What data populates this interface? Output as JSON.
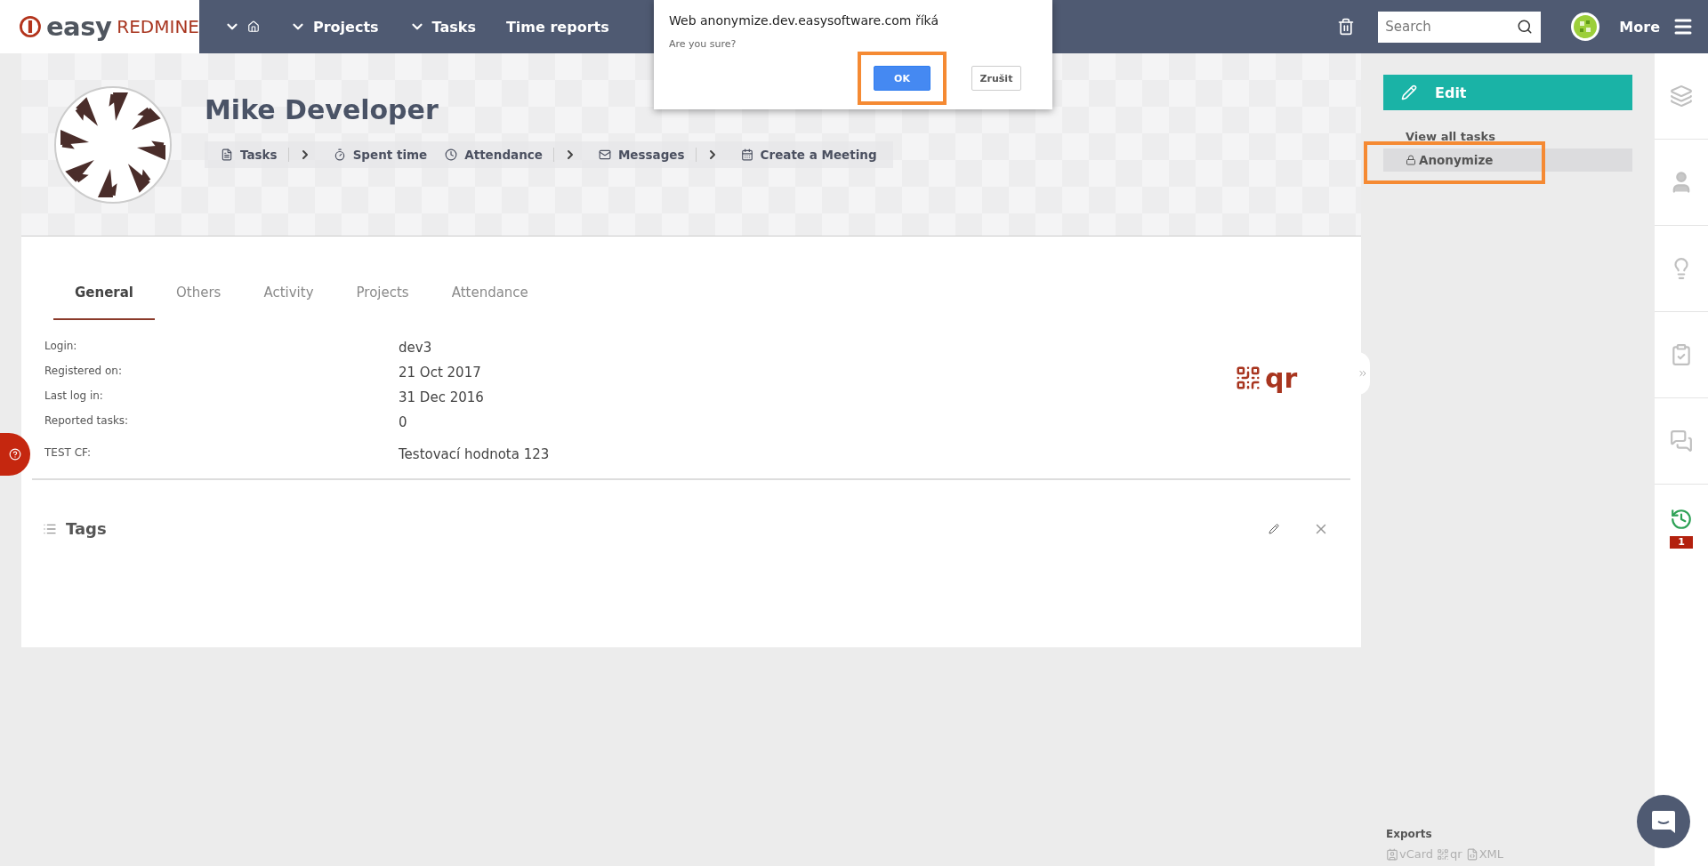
{
  "logo": {
    "brand": "easy",
    "product": "REDMINE"
  },
  "top_nav": {
    "items": [
      {
        "kind": "home",
        "has_menu": true
      },
      {
        "kind": "link",
        "label": "Projects",
        "has_menu": true
      },
      {
        "kind": "link",
        "label": "Tasks",
        "has_menu": true
      },
      {
        "kind": "link",
        "label": "Time reports",
        "has_menu": false
      }
    ],
    "search": {
      "placeholder": "Search"
    },
    "more": "More"
  },
  "dialog": {
    "title": "Web anonymize.dev.easysoftware.com říká",
    "message": "Are you sure?",
    "buttons": [
      {
        "label": "OK",
        "selected": true,
        "highlighted": true
      },
      {
        "label": "Zrušit",
        "selected": false,
        "highlighted": false
      }
    ]
  },
  "profile": {
    "name": "Mike Developer",
    "actions": [
      {
        "kind": "tasks",
        "label": "Tasks",
        "has_menu": true
      },
      {
        "kind": "time",
        "label": "Spent time",
        "has_menu": false
      },
      {
        "kind": "attendance",
        "label": "Attendance",
        "has_menu": true
      },
      {
        "kind": "messages",
        "label": "Messages",
        "has_menu": true
      },
      {
        "kind": "meeting",
        "label": "Create a Meeting",
        "has_menu": false
      }
    ]
  },
  "tabs": [
    {
      "label": "General",
      "selected": true
    },
    {
      "label": "Others",
      "selected": false
    },
    {
      "label": "Activity",
      "selected": false
    },
    {
      "label": "Projects",
      "selected": false
    },
    {
      "label": "Attendance",
      "selected": false
    }
  ],
  "fields": [
    {
      "label": "Login:",
      "value": "dev3"
    },
    {
      "label": "Registered on:",
      "value": "21 Oct 2017"
    },
    {
      "label": "Last log in:",
      "value": "31 Dec 2016"
    },
    {
      "label": "Reported tasks:",
      "value": "0"
    },
    {
      "label": "TEST CF:",
      "value": "Testovací hodnota 123"
    }
  ],
  "qr_label": "qr",
  "tags": {
    "title": "Tags"
  },
  "sidebar": {
    "edit": "Edit",
    "view_all": "View all tasks",
    "anonymize": {
      "label": "Anonymize",
      "highlighted": true
    },
    "exports": {
      "title": "Exports",
      "links": [
        {
          "kind": "vcard",
          "label": "vCard"
        },
        {
          "kind": "qr",
          "label": "qr"
        },
        {
          "kind": "xml",
          "label": "XML"
        }
      ]
    }
  },
  "right_strip": {
    "history_badge": "1"
  }
}
